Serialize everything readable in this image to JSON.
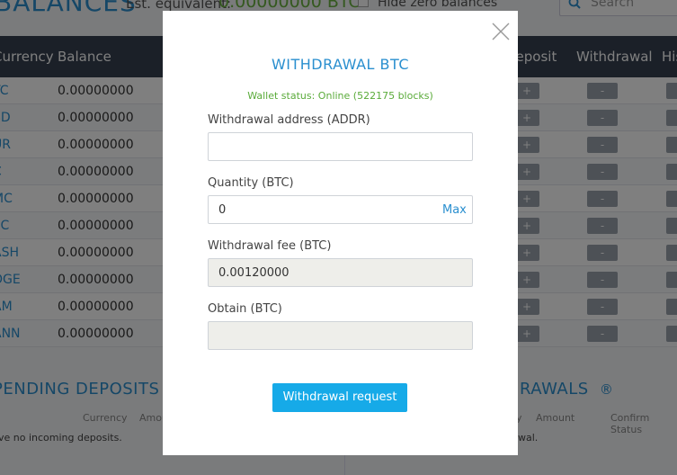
{
  "background": {
    "title": "BALANCES",
    "est_label": "Est. equivalent:",
    "est_value": "0.00000000 BTC",
    "hide_zero_label": "Hide zero balances",
    "search_placeholder": "Search",
    "columns": {
      "currency": "Currency",
      "balance": "Balance",
      "deposit": "Deposit",
      "withdrawal": "Withdrawal",
      "history": "His"
    },
    "rows": [
      {
        "currency": "TC",
        "balance": "0.00000000"
      },
      {
        "currency": "SD",
        "balance": "0.00000000"
      },
      {
        "currency": "UR",
        "balance": "0.00000000"
      },
      {
        "currency": "C",
        "balance": "0.00000000"
      },
      {
        "currency": "MC",
        "balance": "0.00000000"
      },
      {
        "currency": "PC",
        "balance": "0.00000000"
      },
      {
        "currency": "ASH",
        "balance": "0.00000000"
      },
      {
        "currency": "OGE",
        "balance": "0.00000000"
      },
      {
        "currency": "AM",
        "balance": "0.00000000"
      },
      {
        "currency": "ANN",
        "balance": "0.00000000"
      }
    ],
    "deposit_btn": "+",
    "withdraw_btn": "-",
    "pending_deposits": {
      "title": "PENDING DEPOSITS",
      "info_icon": "®",
      "col_currency": "Currency",
      "col_amount": "Amou",
      "message": "ve no incoming deposits."
    },
    "pending_withdrawals": {
      "title": "RAWALS",
      "info_icon": "®",
      "col_y": "y",
      "col_amount": "Amount",
      "col_confirm": "Confirm Status",
      "message": "wal."
    }
  },
  "modal": {
    "title": "WITHDRAWAL BTC",
    "wallet_status": "Wallet status: Online (522175 blocks)",
    "address_label": "Withdrawal address (ADDR)",
    "address_value": "",
    "quantity_label": "Quantity (BTC)",
    "quantity_value": "0",
    "max_label": "Max",
    "fee_label": "Withdrawal fee (BTC)",
    "fee_value": "0.00120000",
    "obtain_label": "Obtain (BTC)",
    "obtain_value": "",
    "submit_label": "Withdrawal request"
  },
  "colors": {
    "accent": "#2a8fcf",
    "button": "#16aae8",
    "online": "#5aab3a",
    "header": "#364151"
  }
}
